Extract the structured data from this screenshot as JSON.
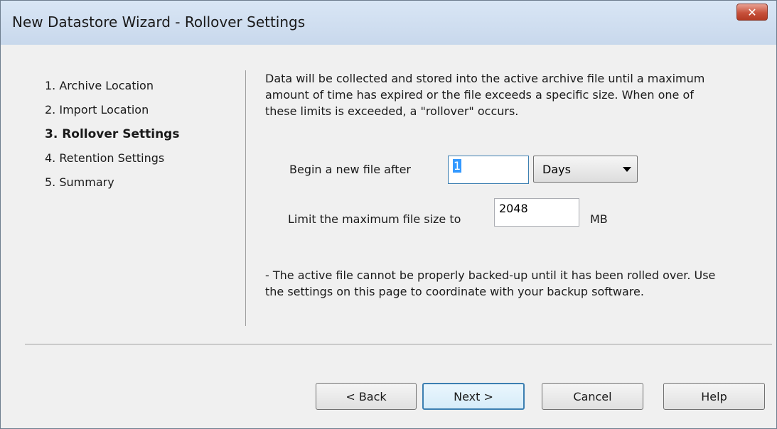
{
  "window": {
    "title": "New Datastore Wizard - Rollover Settings",
    "close_label": "✕"
  },
  "steps": [
    {
      "label": "1. Archive Location",
      "active": false
    },
    {
      "label": "2. Import Location",
      "active": false
    },
    {
      "label": "3. Rollover Settings",
      "active": true
    },
    {
      "label": "4. Retention Settings",
      "active": false
    },
    {
      "label": "5. Summary",
      "active": false
    }
  ],
  "description": "Data will be collected and stored into the active archive file until a maximum amount of time has expired or the file exceeds a specific size. When one of these limits is exceeded, a \"rollover\" occurs.",
  "form": {
    "begin_label": "Begin a new file after",
    "begin_value": "1",
    "period_selected": "Days",
    "limit_label": "Limit the maximum file size to",
    "limit_value": "2048",
    "limit_unit": "MB"
  },
  "note": "- The active file cannot be properly backed-up until it has been rolled over. Use the settings on this page to coordinate with your backup software.",
  "buttons": {
    "back": "< Back",
    "next": "Next >",
    "cancel": "Cancel",
    "help": "Help"
  }
}
